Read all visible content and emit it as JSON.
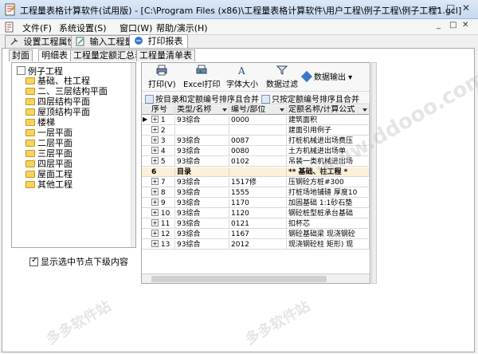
{
  "window": {
    "title": "工程量表格计算软件(试用版) - [C:\\Program Files (x86)\\工程量表格计算软件\\用户工程\\例子工程\\例子工程1.gcl]",
    "controls": [
      "—",
      "□",
      "✕"
    ]
  },
  "menu": {
    "items": [
      "文件(F)",
      "系统设置(S)",
      "窗口(W)",
      "帮助/演示(H)"
    ],
    "right_controls": [
      "_",
      "□",
      "✕"
    ]
  },
  "main_tabs": [
    {
      "label": "设置工程属性"
    },
    {
      "label": "输入工程量"
    },
    {
      "label": "打印报表"
    }
  ],
  "sub_tabs": [
    "封面",
    "明细表",
    "工程量定额汇总表",
    "工程量清单表"
  ],
  "tree": {
    "root": "例子工程",
    "items": [
      "基础、柱工程",
      "二、三层结构平面",
      "四层结构平面",
      "屋顶结构平面",
      "楼梯",
      "一层平面",
      "二层平面",
      "三层平面",
      "四层平面",
      "屋面工程",
      "其他工程"
    ]
  },
  "show_children_label": "显示选中节点下级内容",
  "toolbar": {
    "buttons": [
      "打印(V)",
      "Excel打印",
      "字体大小",
      "数据过滤",
      "数据输出"
    ],
    "merge_buttons": [
      "按目录和定额编号排序且合并",
      "只按定额编号排序且合并"
    ]
  },
  "grid": {
    "headers": [
      "序号",
      "类型/名称",
      "编号/部位",
      "定额名称/计算公式"
    ],
    "rows": [
      {
        "seq": "1",
        "type": "93综合",
        "code": "0000",
        "name": "建筑面积"
      },
      {
        "seq": "2",
        "type": "",
        "code": "",
        "name": "建面引用例子"
      },
      {
        "seq": "3",
        "type": "93综合",
        "code": "0087",
        "name": "打桩机械进出场费压"
      },
      {
        "seq": "4",
        "type": "93综合",
        "code": "0080",
        "name": "土方机械进出场单"
      },
      {
        "seq": "5",
        "type": "93综合",
        "code": "0102",
        "name": "吊装一类机械进出场"
      },
      {
        "seq": "6",
        "type": "目录",
        "code": "",
        "name": "** 基础、柱工程 *",
        "section": true
      },
      {
        "seq": "7",
        "type": "93综合",
        "code": "1517修",
        "name": "压钢砼方桩#300"
      },
      {
        "seq": "8",
        "type": "93综合",
        "code": "1555",
        "name": "打桩场地铺碴 厚度10"
      },
      {
        "seq": "9",
        "type": "93综合",
        "code": "1170",
        "name": "加固基础 1:1砂石垫"
      },
      {
        "seq": "10",
        "type": "93综合",
        "code": "1120",
        "name": "钢砼桩型桩承台基础"
      },
      {
        "seq": "11",
        "type": "93综合",
        "code": "0121",
        "name": "扣杯芯"
      },
      {
        "seq": "12",
        "type": "93综合",
        "code": "1167",
        "name": "钢砼基础梁 现浇钢砼"
      },
      {
        "seq": "13",
        "type": "93综合",
        "code": "2012",
        "name": "现浇钢砼柱 矩形) 现"
      }
    ]
  },
  "watermarks": [
    "www.ddooo.com",
    "多多软件站"
  ]
}
